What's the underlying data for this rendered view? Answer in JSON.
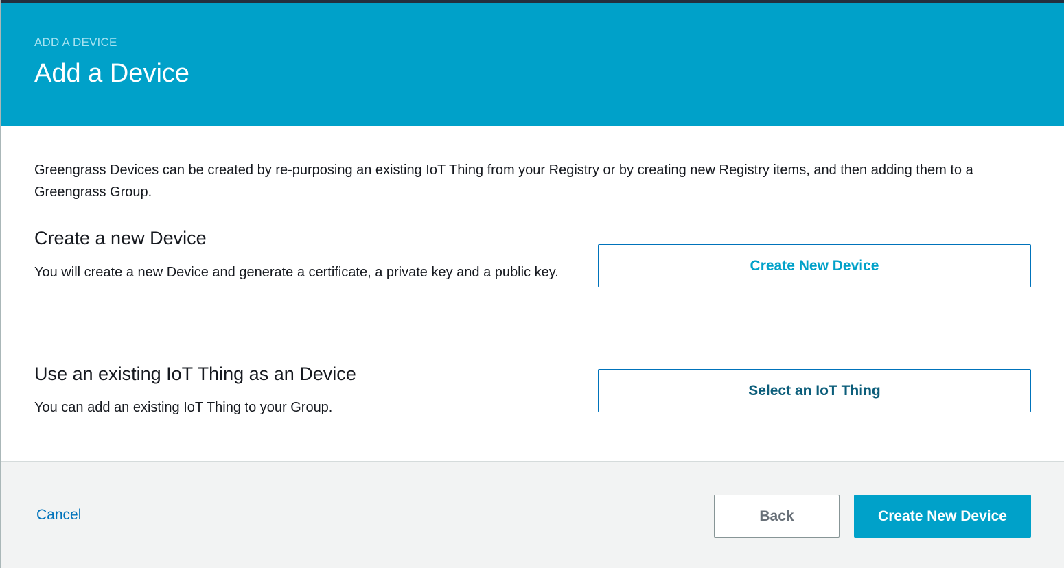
{
  "header": {
    "eyebrow": "ADD A DEVICE",
    "title": "Add a Device"
  },
  "intro": "Greengrass Devices can be created by re-purposing an existing IoT Thing from your Registry or by creating new Registry items, and then adding them to a Greengrass Group.",
  "sections": [
    {
      "title": "Create a new Device",
      "description": "You will create a new Device and generate a certificate, a private key and a public key.",
      "button_label": "Create New Device"
    },
    {
      "title": "Use an existing IoT Thing as an Device",
      "description": "You can add an existing IoT Thing to your Group.",
      "button_label": "Select an IoT Thing"
    }
  ],
  "footer": {
    "cancel_label": "Cancel",
    "back_label": "Back",
    "primary_label": "Create New Device"
  },
  "colors": {
    "header_bg": "#00a1c9",
    "primary_button": "#00a1c9",
    "link": "#0073bb",
    "footer_bg": "#f2f3f3"
  }
}
